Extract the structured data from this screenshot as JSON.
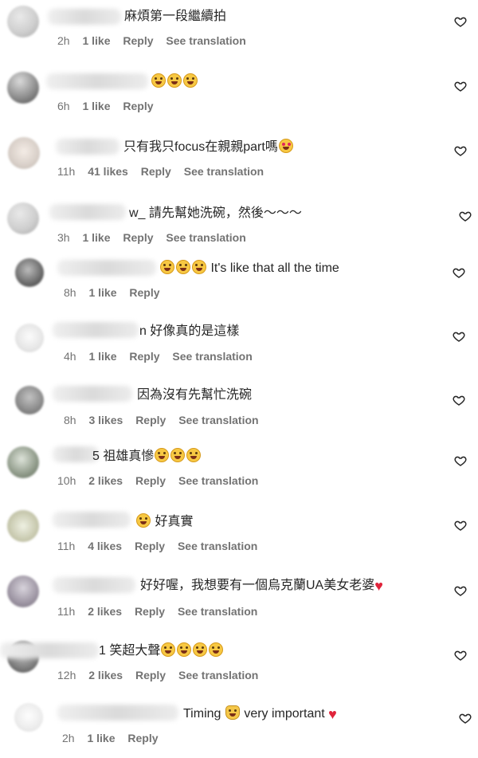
{
  "comments": [
    {
      "text": "麻煩第一段繼續拍",
      "time": "2h",
      "likes": "1 like",
      "reply": "Reply",
      "translate": "See translation"
    },
    {
      "text": "",
      "time": "6h",
      "likes": "1 like",
      "reply": "Reply",
      "translate": ""
    },
    {
      "text": "只有我只focus在親親part嗎",
      "time": "11h",
      "likes": "41 likes",
      "reply": "Reply",
      "translate": "See translation"
    },
    {
      "text": "w_ 請先幫她洗碗，然後～～～",
      "time": "3h",
      "likes": "1 like",
      "reply": "Reply",
      "translate": "See translation"
    },
    {
      "text": "It's like that all the time",
      "time": "8h",
      "likes": "1 like",
      "reply": "Reply",
      "translate": ""
    },
    {
      "text": "n 好像真的是這樣",
      "time": "4h",
      "likes": "1 like",
      "reply": "Reply",
      "translate": "See translation"
    },
    {
      "text": "因為沒有先幫忙洗碗",
      "time": "8h",
      "likes": "3 likes",
      "reply": "Reply",
      "translate": "See translation"
    },
    {
      "text": "5 祖雄真慘",
      "time": "10h",
      "likes": "2 likes",
      "reply": "Reply",
      "translate": "See translation"
    },
    {
      "text": "好真實",
      "time": "11h",
      "likes": "4 likes",
      "reply": "Reply",
      "translate": "See translation"
    },
    {
      "text": "好好喔，我想要有一個烏克蘭UA美女老婆",
      "time": "11h",
      "likes": "2 likes",
      "reply": "Reply",
      "translate": "See translation"
    },
    {
      "text": "1 笑超大聲",
      "time": "12h",
      "likes": "2 likes",
      "reply": "Reply",
      "translate": "See translation"
    },
    {
      "text": "Timing",
      "text2": "very important",
      "time": "2h",
      "likes": "1 like",
      "reply": "Reply",
      "translate": ""
    }
  ],
  "icons": {
    "like": "heart-outline-icon",
    "laugh": "face-with-tears-of-joy-emoji",
    "heart_eyes": "heart-eyes-emoji",
    "red_heart": "red-heart-emoji",
    "raised_hands": "raised-hands-emoji"
  }
}
